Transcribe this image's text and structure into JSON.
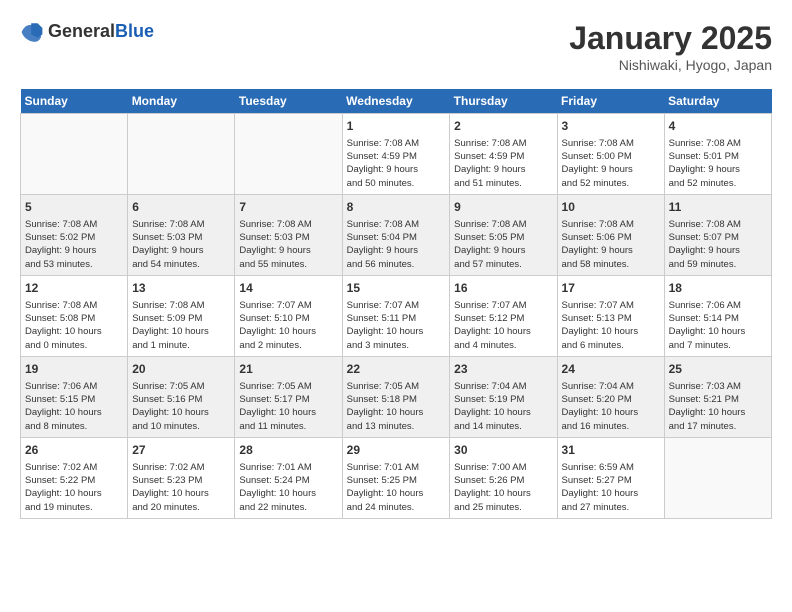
{
  "header": {
    "logo_general": "General",
    "logo_blue": "Blue",
    "month_title": "January 2025",
    "location": "Nishiwaki, Hyogo, Japan"
  },
  "days_of_week": [
    "Sunday",
    "Monday",
    "Tuesday",
    "Wednesday",
    "Thursday",
    "Friday",
    "Saturday"
  ],
  "weeks": [
    [
      {
        "num": "",
        "info": ""
      },
      {
        "num": "",
        "info": ""
      },
      {
        "num": "",
        "info": ""
      },
      {
        "num": "1",
        "info": "Sunrise: 7:08 AM\nSunset: 4:59 PM\nDaylight: 9 hours\nand 50 minutes."
      },
      {
        "num": "2",
        "info": "Sunrise: 7:08 AM\nSunset: 4:59 PM\nDaylight: 9 hours\nand 51 minutes."
      },
      {
        "num": "3",
        "info": "Sunrise: 7:08 AM\nSunset: 5:00 PM\nDaylight: 9 hours\nand 52 minutes."
      },
      {
        "num": "4",
        "info": "Sunrise: 7:08 AM\nSunset: 5:01 PM\nDaylight: 9 hours\nand 52 minutes."
      }
    ],
    [
      {
        "num": "5",
        "info": "Sunrise: 7:08 AM\nSunset: 5:02 PM\nDaylight: 9 hours\nand 53 minutes."
      },
      {
        "num": "6",
        "info": "Sunrise: 7:08 AM\nSunset: 5:03 PM\nDaylight: 9 hours\nand 54 minutes."
      },
      {
        "num": "7",
        "info": "Sunrise: 7:08 AM\nSunset: 5:03 PM\nDaylight: 9 hours\nand 55 minutes."
      },
      {
        "num": "8",
        "info": "Sunrise: 7:08 AM\nSunset: 5:04 PM\nDaylight: 9 hours\nand 56 minutes."
      },
      {
        "num": "9",
        "info": "Sunrise: 7:08 AM\nSunset: 5:05 PM\nDaylight: 9 hours\nand 57 minutes."
      },
      {
        "num": "10",
        "info": "Sunrise: 7:08 AM\nSunset: 5:06 PM\nDaylight: 9 hours\nand 58 minutes."
      },
      {
        "num": "11",
        "info": "Sunrise: 7:08 AM\nSunset: 5:07 PM\nDaylight: 9 hours\nand 59 minutes."
      }
    ],
    [
      {
        "num": "12",
        "info": "Sunrise: 7:08 AM\nSunset: 5:08 PM\nDaylight: 10 hours\nand 0 minutes."
      },
      {
        "num": "13",
        "info": "Sunrise: 7:08 AM\nSunset: 5:09 PM\nDaylight: 10 hours\nand 1 minute."
      },
      {
        "num": "14",
        "info": "Sunrise: 7:07 AM\nSunset: 5:10 PM\nDaylight: 10 hours\nand 2 minutes."
      },
      {
        "num": "15",
        "info": "Sunrise: 7:07 AM\nSunset: 5:11 PM\nDaylight: 10 hours\nand 3 minutes."
      },
      {
        "num": "16",
        "info": "Sunrise: 7:07 AM\nSunset: 5:12 PM\nDaylight: 10 hours\nand 4 minutes."
      },
      {
        "num": "17",
        "info": "Sunrise: 7:07 AM\nSunset: 5:13 PM\nDaylight: 10 hours\nand 6 minutes."
      },
      {
        "num": "18",
        "info": "Sunrise: 7:06 AM\nSunset: 5:14 PM\nDaylight: 10 hours\nand 7 minutes."
      }
    ],
    [
      {
        "num": "19",
        "info": "Sunrise: 7:06 AM\nSunset: 5:15 PM\nDaylight: 10 hours\nand 8 minutes."
      },
      {
        "num": "20",
        "info": "Sunrise: 7:05 AM\nSunset: 5:16 PM\nDaylight: 10 hours\nand 10 minutes."
      },
      {
        "num": "21",
        "info": "Sunrise: 7:05 AM\nSunset: 5:17 PM\nDaylight: 10 hours\nand 11 minutes."
      },
      {
        "num": "22",
        "info": "Sunrise: 7:05 AM\nSunset: 5:18 PM\nDaylight: 10 hours\nand 13 minutes."
      },
      {
        "num": "23",
        "info": "Sunrise: 7:04 AM\nSunset: 5:19 PM\nDaylight: 10 hours\nand 14 minutes."
      },
      {
        "num": "24",
        "info": "Sunrise: 7:04 AM\nSunset: 5:20 PM\nDaylight: 10 hours\nand 16 minutes."
      },
      {
        "num": "25",
        "info": "Sunrise: 7:03 AM\nSunset: 5:21 PM\nDaylight: 10 hours\nand 17 minutes."
      }
    ],
    [
      {
        "num": "26",
        "info": "Sunrise: 7:02 AM\nSunset: 5:22 PM\nDaylight: 10 hours\nand 19 minutes."
      },
      {
        "num": "27",
        "info": "Sunrise: 7:02 AM\nSunset: 5:23 PM\nDaylight: 10 hours\nand 20 minutes."
      },
      {
        "num": "28",
        "info": "Sunrise: 7:01 AM\nSunset: 5:24 PM\nDaylight: 10 hours\nand 22 minutes."
      },
      {
        "num": "29",
        "info": "Sunrise: 7:01 AM\nSunset: 5:25 PM\nDaylight: 10 hours\nand 24 minutes."
      },
      {
        "num": "30",
        "info": "Sunrise: 7:00 AM\nSunset: 5:26 PM\nDaylight: 10 hours\nand 25 minutes."
      },
      {
        "num": "31",
        "info": "Sunrise: 6:59 AM\nSunset: 5:27 PM\nDaylight: 10 hours\nand 27 minutes."
      },
      {
        "num": "",
        "info": ""
      }
    ]
  ]
}
